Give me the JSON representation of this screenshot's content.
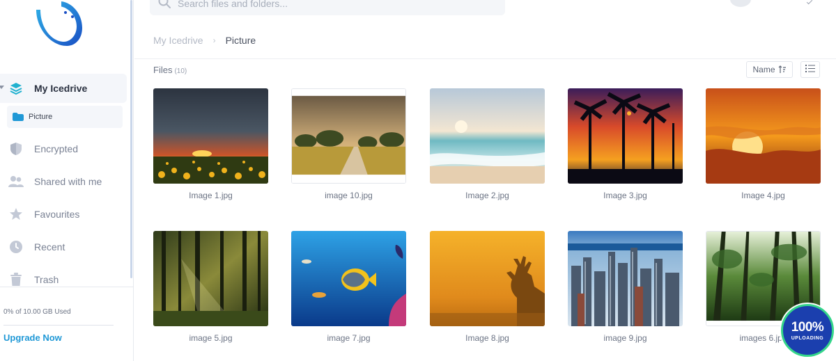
{
  "search": {
    "placeholder": "Search files and folders..."
  },
  "sidebar": {
    "items": [
      {
        "label": "My Icedrive",
        "icon": "layers-icon"
      },
      {
        "label": "Encrypted",
        "icon": "shield-icon"
      },
      {
        "label": "Shared with me",
        "icon": "users-icon"
      },
      {
        "label": "Favourites",
        "icon": "star-icon"
      },
      {
        "label": "Recent",
        "icon": "clock-icon"
      },
      {
        "label": "Trash",
        "icon": "trash-icon"
      }
    ],
    "subfolder": {
      "label": "Picture",
      "icon": "folder-icon"
    },
    "storage_text": "0% of 10.00 GB Used",
    "upgrade_label": "Upgrade Now"
  },
  "breadcrumb": {
    "root": "My Icedrive",
    "separator": "›",
    "current": "Picture"
  },
  "files": {
    "title": "Files",
    "count": "(10)",
    "sort_label": "Name",
    "items": [
      {
        "name": "Image 1.jpg"
      },
      {
        "name": "image 10.jpg"
      },
      {
        "name": "Image 2.jpg"
      },
      {
        "name": "Image 3.jpg"
      },
      {
        "name": "Image 4.jpg"
      },
      {
        "name": "image 5.jpg"
      },
      {
        "name": "image 7.jpg"
      },
      {
        "name": "Image 8.jpg"
      },
      {
        "name": "image 9.jpg"
      },
      {
        "name": "images 6.jpg"
      }
    ]
  },
  "upload": {
    "percent": "100%",
    "label": "UPLOADING",
    "progress": 1.0
  },
  "colors": {
    "accent": "#1f98d6",
    "badge_bg": "#1b3fae",
    "badge_ring": "#35d68a",
    "folder": "#1f98d6"
  }
}
